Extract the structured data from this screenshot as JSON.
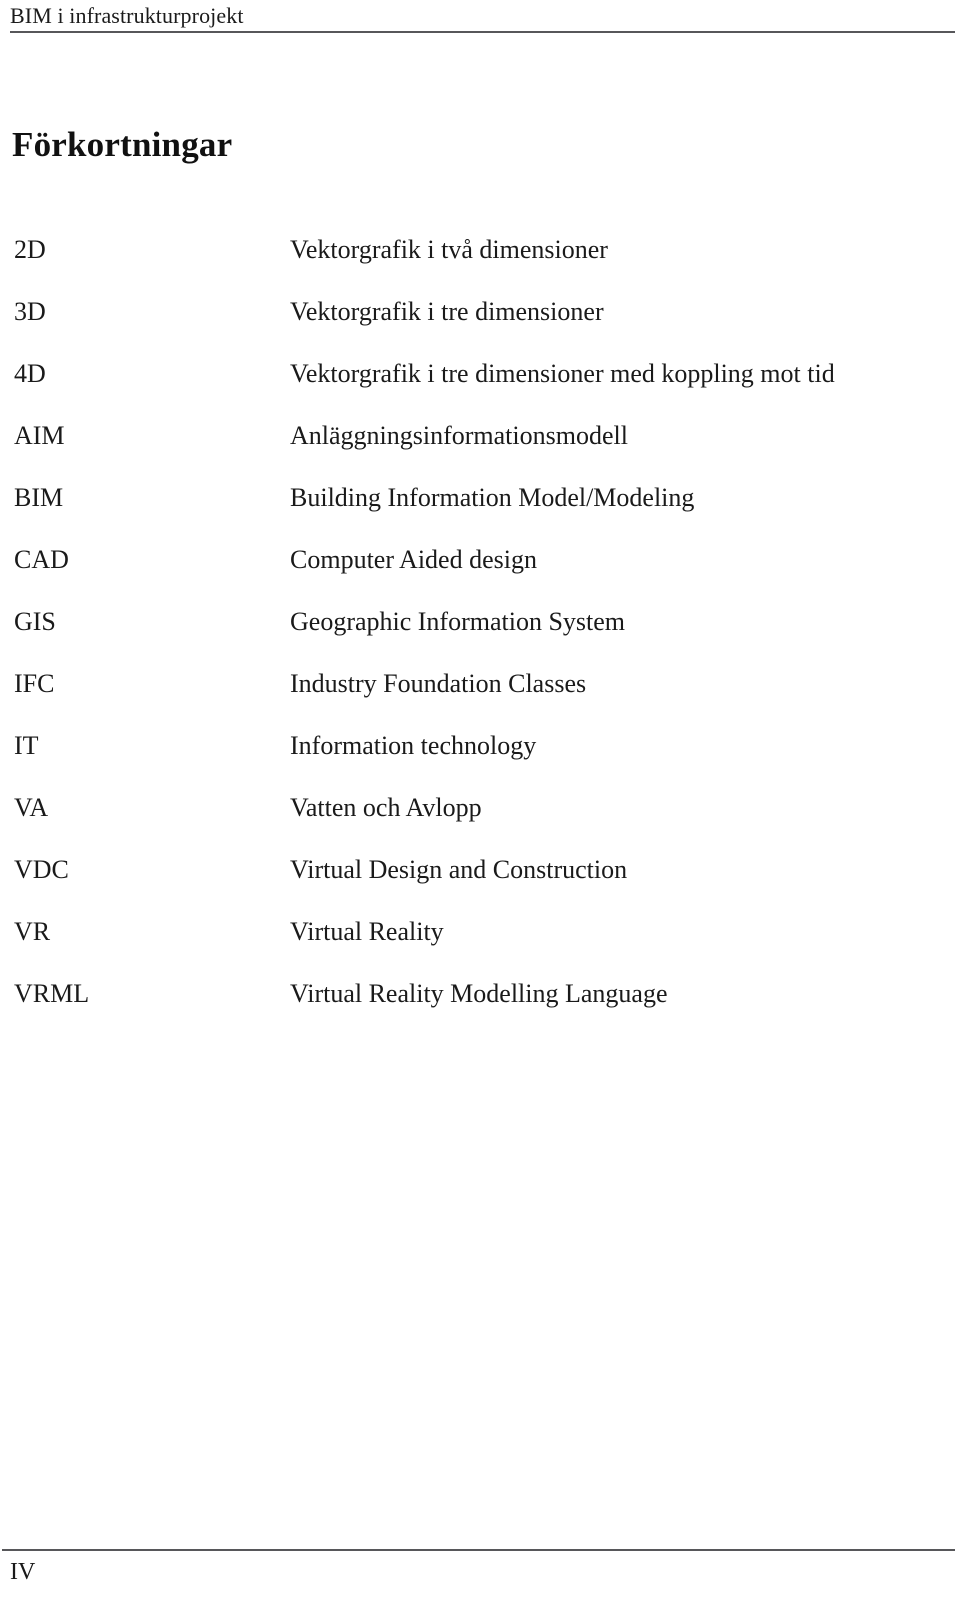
{
  "header": {
    "running_title": "BIM i infrastrukturprojekt"
  },
  "heading": {
    "title": "Förkortningar"
  },
  "abbreviations": [
    {
      "term": "2D",
      "definition": "Vektorgrafik i två dimensioner"
    },
    {
      "term": "3D",
      "definition": "Vektorgrafik i tre dimensioner"
    },
    {
      "term": "4D",
      "definition": "Vektorgrafik i tre dimensioner med koppling mot tid"
    },
    {
      "term": "AIM",
      "definition": "Anläggningsinformationsmodell"
    },
    {
      "term": "BIM",
      "definition": "Building Information Model/Modeling"
    },
    {
      "term": "CAD",
      "definition": "Computer Aided design"
    },
    {
      "term": "GIS",
      "definition": "Geographic Information System"
    },
    {
      "term": "IFC",
      "definition": "Industry Foundation Classes"
    },
    {
      "term": "IT",
      "definition": "Information technology"
    },
    {
      "term": "VA",
      "definition": "Vatten och Avlopp"
    },
    {
      "term": "VDC",
      "definition": "Virtual Design and Construction"
    },
    {
      "term": "VR",
      "definition": "Virtual Reality"
    },
    {
      "term": "VRML",
      "definition": "Virtual Reality Modelling Language"
    }
  ],
  "footer": {
    "page_number": "IV"
  },
  "colors": {
    "text": "#1a1a1a",
    "rule": "#57575a",
    "background": "#ffffff"
  }
}
